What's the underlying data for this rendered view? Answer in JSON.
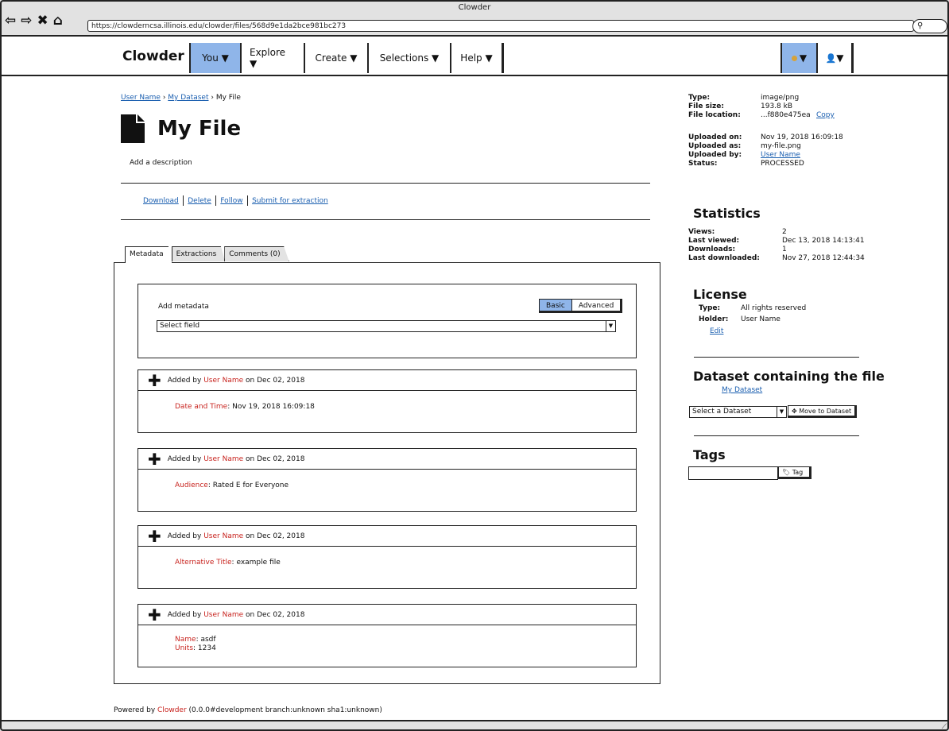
{
  "window": {
    "title": "Clowder",
    "url": "https://clowderncsa.illinois.edu/clowder/files/568d9e1da2bce981bc273",
    "nav_icons": [
      "back-arrow-icon",
      "forward-arrow-icon",
      "stop-icon",
      "home-icon"
    ]
  },
  "navbar": {
    "brand": "Clowder",
    "menus": [
      {
        "label": "You ▼",
        "active": true
      },
      {
        "label": "Explore ▼",
        "active": false
      },
      {
        "label": "Create ▼",
        "active": false
      },
      {
        "label": "Selections ▼",
        "active": false
      },
      {
        "label": "Help ▼",
        "active": false
      }
    ],
    "right_menus": [
      {
        "icon": "gear-icon",
        "label": "▼"
      },
      {
        "icon": "user-icon",
        "label": "▼"
      }
    ]
  },
  "breadcrumb": {
    "user": "User Name",
    "sep": "›",
    "dataset": "My Dataset",
    "current": "My File"
  },
  "file": {
    "title": "My File",
    "description_prompt": "Add a description"
  },
  "actions": [
    "Download",
    "Delete",
    "Follow",
    "Submit for extraction"
  ],
  "tabs": [
    {
      "label": "Metadata",
      "active": true
    },
    {
      "label": "Extractions",
      "active": false
    },
    {
      "label": "Comments (0)",
      "active": false
    }
  ],
  "metadata_form": {
    "label": "Add metadata",
    "toggle": [
      "Basic",
      "Advanced"
    ],
    "select_placeholder": "Select field"
  },
  "metadata_entries": [
    {
      "prefix": "Added by",
      "user": "User Name",
      "on": "on Dec 02, 2018",
      "fields": [
        {
          "key": "Date and Time",
          "value": "Nov 19, 2018 16:09:18"
        }
      ]
    },
    {
      "prefix": "Added by",
      "user": "User Name",
      "on": "on Dec 02, 2018",
      "fields": [
        {
          "key": "Audience",
          "value": "Rated E for Everyone"
        }
      ]
    },
    {
      "prefix": "Added by",
      "user": "User Name",
      "on": "on Dec 02, 2018",
      "fields": [
        {
          "key": "Alternative Title",
          "value": "example file"
        }
      ]
    },
    {
      "prefix": "Added by",
      "user": "User Name",
      "on": "on Dec 02, 2018",
      "fields": [
        {
          "key": "Name",
          "value": "asdf"
        },
        {
          "key": "Units",
          "value": "1234"
        }
      ]
    }
  ],
  "footer": {
    "prefix": "Powered by",
    "brand": "Clowder",
    "version": "(0.0.0#development branch:unknown sha1:unknown)"
  },
  "file_info": {
    "type_label": "Type:",
    "type": "image/png",
    "size_label": "File size:",
    "size": "193.8 kB",
    "location_label": "File location:",
    "location": "...f880e475ea",
    "copy": "Copy",
    "uploaded_on_label": "Uploaded on:",
    "uploaded_on": "Nov 19, 2018 16:09:18",
    "uploaded_as_label": "Uploaded as:",
    "uploaded_as": "my-file.png",
    "uploaded_by_label": "Uploaded by:",
    "uploaded_by": "User Name",
    "status_label": "Status:",
    "status": "PROCESSED"
  },
  "statistics": {
    "heading": "Statistics",
    "views_label": "Views:",
    "views": "2",
    "last_viewed_label": "Last viewed:",
    "last_viewed": "Dec 13, 2018 14:13:41",
    "downloads_label": "Downloads:",
    "downloads": "1",
    "last_downloaded_label": "Last downloaded:",
    "last_downloaded": "Nov 27, 2018 12:44:34"
  },
  "license": {
    "heading": "License",
    "type_label": "Type:",
    "type": "All rights reserved",
    "holder_label": "Holder:",
    "holder": "User Name",
    "edit": "Edit"
  },
  "dataset_section": {
    "heading": "Dataset containing the file",
    "dataset_link": "My Dataset",
    "select_placeholder": "Select a Dataset",
    "move_button": "Move to Dataset"
  },
  "tags": {
    "heading": "Tags",
    "button": "Tag"
  }
}
